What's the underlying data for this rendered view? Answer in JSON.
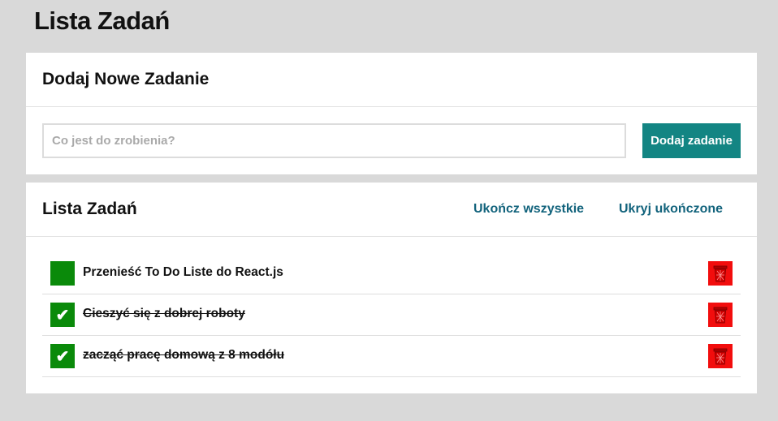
{
  "app": {
    "title": "Lista Zadań"
  },
  "add_panel": {
    "title": "Dodaj Nowe Zadanie",
    "input_placeholder": "Co jest do zrobienia?",
    "input_value": "",
    "button_label": "Dodaj zadanie"
  },
  "list_panel": {
    "title": "Lista Zadań",
    "complete_all_label": "Ukończ wszystkie",
    "hide_completed_label": "Ukryj ukończone",
    "tasks": [
      {
        "text": "Przenieść To Do Liste do React.js",
        "done": false,
        "check_mark": ""
      },
      {
        "text": "Cieszyć się z dobrej roboty",
        "done": true,
        "check_mark": "✔"
      },
      {
        "text": "zacząć pracę domową z 8 modółu",
        "done": true,
        "check_mark": "✔"
      }
    ]
  },
  "colors": {
    "accent": "#138583",
    "link": "#12637c",
    "check": "#0a8a0a",
    "delete": "#f20d0d",
    "background": "#d9d9d9"
  },
  "icons": {
    "check": "check-icon",
    "delete": "trash-icon"
  }
}
